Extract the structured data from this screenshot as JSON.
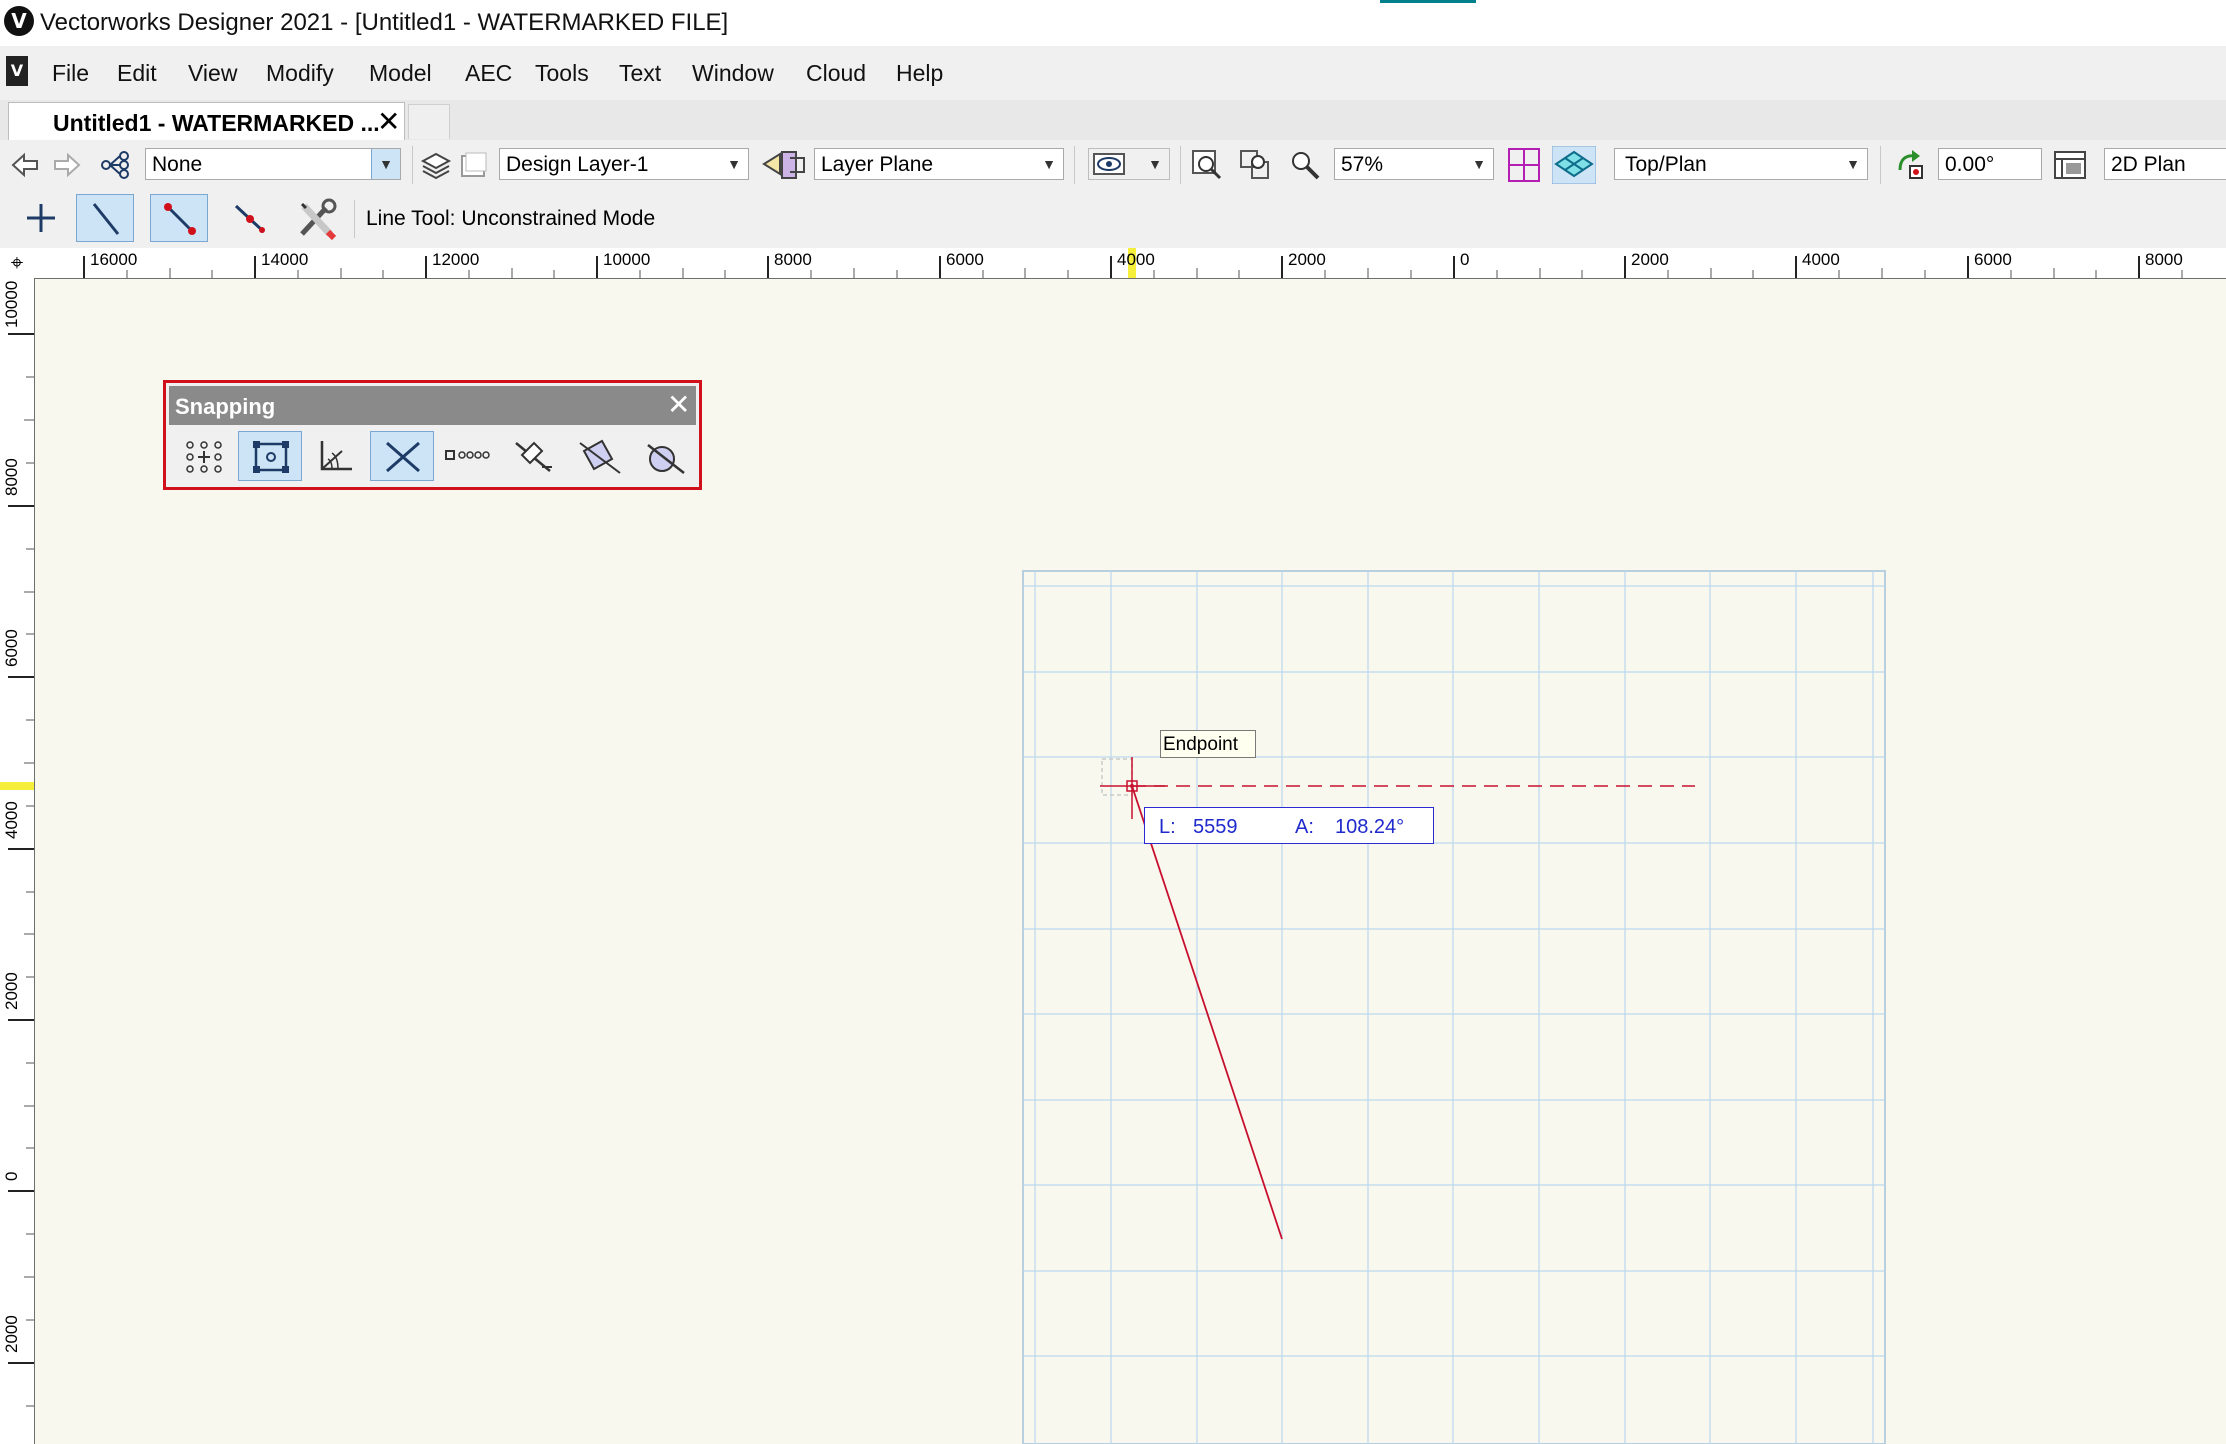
{
  "window": {
    "title": "Vectorworks Designer 2021 - [Untitled1 - WATERMARKED FILE]",
    "logo": "V"
  },
  "menu": {
    "items": [
      "File",
      "Edit",
      "View",
      "Modify",
      "Model",
      "AEC",
      "Tools",
      "Text",
      "Window",
      "Cloud",
      "Help"
    ]
  },
  "tab": {
    "label": "Untitled1 - WATERMARKED ...",
    "close": "✕"
  },
  "viewbar": {
    "class_value": "None",
    "layer_value": "Design Layer-1",
    "plane_value": "Layer Plane",
    "zoom_value": "57%",
    "view_value": "Top/Plan",
    "rotation_value": "0.00°",
    "render_value": "2D Plan"
  },
  "toolbar": {
    "status": "Line Tool: Unconstrained Mode"
  },
  "ruler": {
    "top_labels": [
      "16000",
      "14000",
      "12000",
      "10000",
      "8000",
      "6000",
      "4000",
      "2000",
      "0",
      "2000",
      "4000",
      "6000",
      "8000"
    ],
    "left_labels": [
      "10000",
      "8000",
      "6000",
      "4000",
      "2000",
      "0",
      "2000"
    ]
  },
  "snapping": {
    "title": "Snapping",
    "close": "✕"
  },
  "drawing": {
    "endpoint_label": "Endpoint",
    "length_label": "L:",
    "length_value": "5559",
    "angle_label": "A:",
    "angle_value": "108.24°"
  },
  "colors": {
    "canvas": "#f9f8ef",
    "grid": "#bcd8ee",
    "line": "#c8102e",
    "highlight": "#d0111b",
    "accent": "#00808a"
  }
}
